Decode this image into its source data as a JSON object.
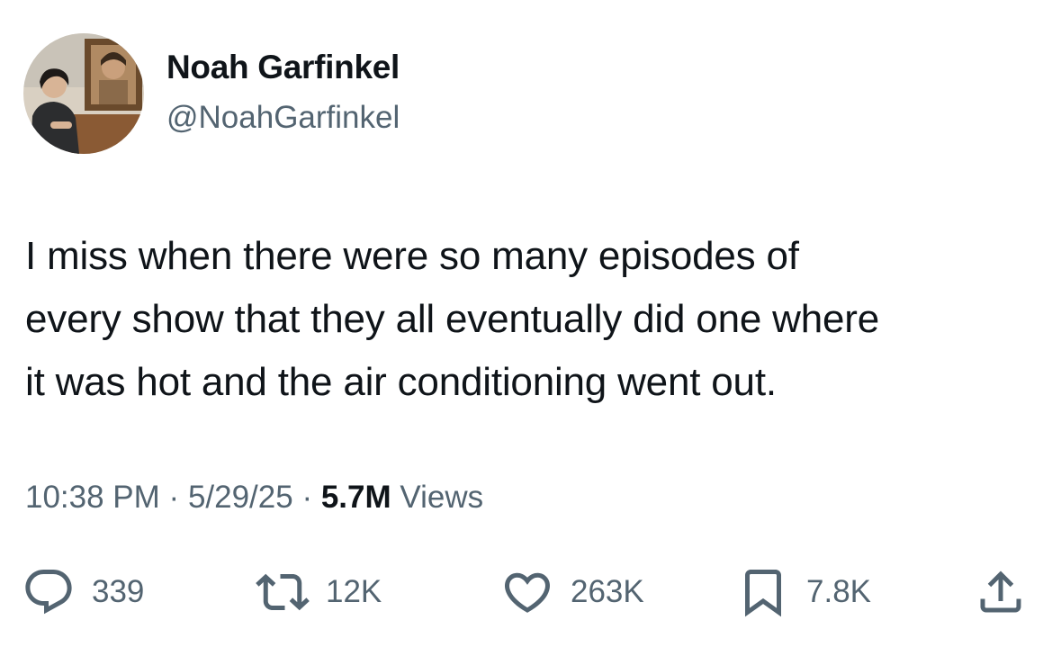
{
  "author": {
    "display_name": "Noah Garfinkel",
    "handle": "@NoahGarfinkel"
  },
  "tweet": {
    "lines": [
      "I miss when there were so many episodes of",
      "every show that they all eventually did one where",
      "it was hot and the air conditioning went out."
    ]
  },
  "meta": {
    "time": "10:38 PM",
    "separator": "·",
    "date": "5/29/25",
    "views_count": "5.7M",
    "views_label": "Views"
  },
  "actions": {
    "reply": {
      "icon": "reply-icon",
      "count": "339"
    },
    "retweet": {
      "icon": "retweet-icon",
      "count": "12K"
    },
    "like": {
      "icon": "heart-icon",
      "count": "263K"
    },
    "bookmark": {
      "icon": "bookmark-icon",
      "count": "7.8K"
    },
    "share": {
      "icon": "share-icon"
    }
  },
  "colors": {
    "text_primary": "#0f1419",
    "text_secondary": "#536471",
    "background": "#ffffff"
  }
}
